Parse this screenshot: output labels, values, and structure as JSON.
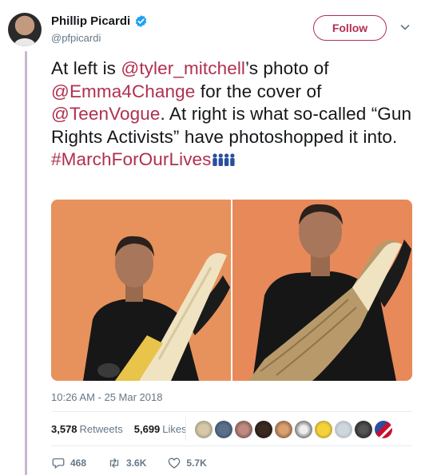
{
  "author": {
    "display_name": "Phillip Picardi",
    "handle": "@pfpicardi",
    "verified": true
  },
  "follow_label": "Follow",
  "tweet": {
    "t1": "At left is ",
    "m1": "@tyler_mitchell",
    "t2": "’s photo of ",
    "m2": "@Emma4Change",
    "t3": " for the cover of ",
    "m3": "@TeenVogue",
    "t4": ". At right is what so-called “Gun Rights Activists” have photoshopped it into.",
    "hashtag": "#MarchForOurLives"
  },
  "timestamp": "10:26 AM - 25 Mar 2018",
  "stats": {
    "retweets_count": "3,578",
    "retweets_label": "Retweets",
    "likes_count": "5,699",
    "likes_label": "Likes"
  },
  "actions": {
    "replies": "468",
    "retweets": "3.6K",
    "likes": "5.7K"
  },
  "colors": {
    "accent": "#b0304f",
    "verified": "#1da1f2",
    "muted": "#657786"
  },
  "icons": [
    "verified-badge-icon",
    "chevron-down-icon",
    "reply-icon",
    "retweet-icon",
    "like-icon",
    "people-emoji-icon"
  ]
}
